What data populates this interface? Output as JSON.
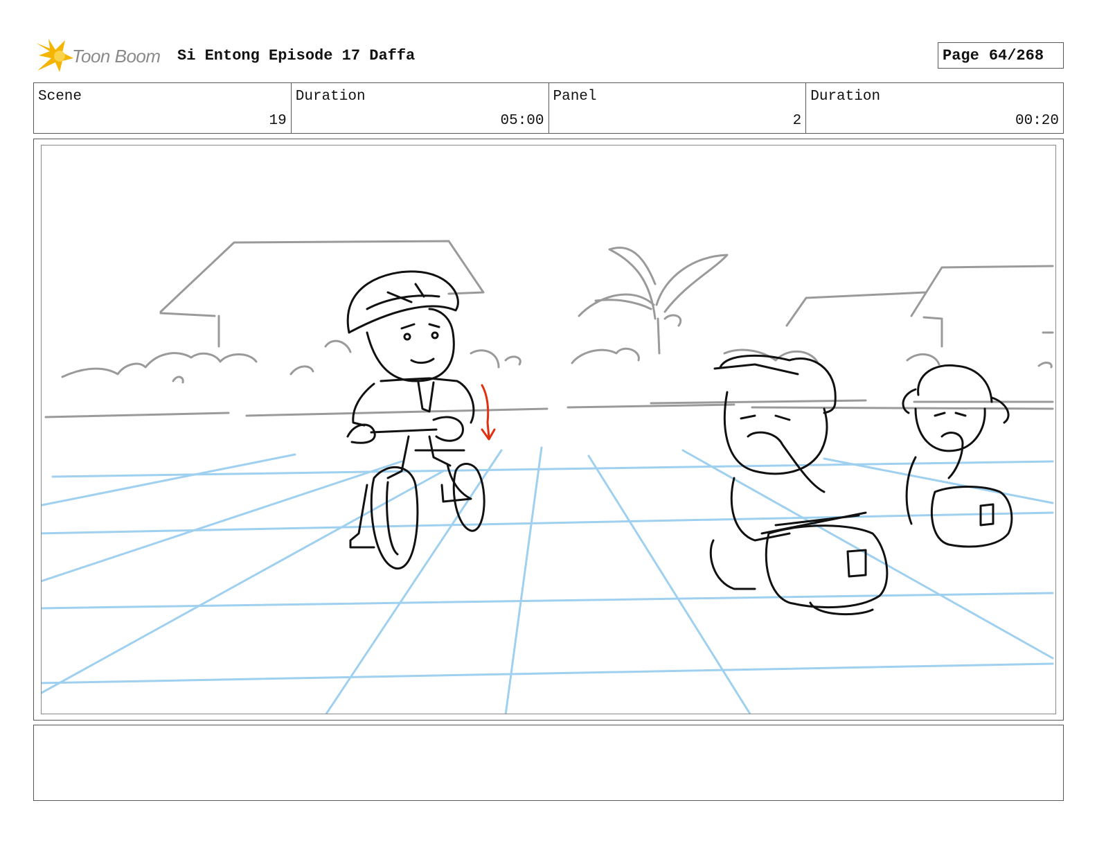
{
  "header": {
    "logo_text": "Toon Boom",
    "title": "Si Entong Episode 17 Daffa",
    "page_label": "Page",
    "page_number": "64/268"
  },
  "info": {
    "scene_label": "Scene",
    "scene_value": "19",
    "scene_duration_label": "Duration",
    "scene_duration_value": "05:00",
    "panel_label": "Panel",
    "panel_value": "2",
    "panel_duration_label": "Duration",
    "panel_duration_value": "00:20"
  },
  "colors": {
    "sketch": "#111111",
    "background_sketch": "#9a9a9a",
    "perspective_grid": "#9fd0f0",
    "motion_arrow": "#e03010",
    "logo_accent": "#f5b400"
  },
  "notes": {
    "text": ""
  }
}
